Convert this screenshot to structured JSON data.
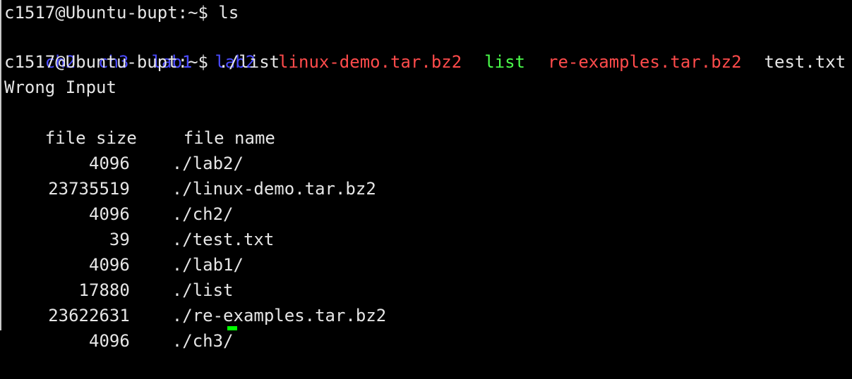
{
  "terminal": {
    "prompt_1": "c1517@Ubuntu-bupt:~$ ls",
    "ls_output": [
      {
        "name": "ch2",
        "color": "#4b4bff"
      },
      {
        "name": "ch3",
        "color": "#4b4bff"
      },
      {
        "name": "lab1",
        "color": "#4b4bff"
      },
      {
        "name": "lab2",
        "color": "#4b4bff"
      },
      {
        "name": "linux-demo.tar.bz2",
        "color": "#ff4b4b"
      },
      {
        "name": "list",
        "color": "#4bff4b"
      },
      {
        "name": "re-examples.tar.bz2",
        "color": "#ff4b4b"
      },
      {
        "name": "test.txt",
        "color": "#e6e6e6"
      }
    ],
    "prompt_2": "c1517@Ubuntu-bupt:~$ ./list",
    "message": "Wrong Input",
    "header_size": "file size",
    "header_name": "file name",
    "rows": [
      {
        "size": "4096",
        "name": "./lab2/"
      },
      {
        "size": "23735519",
        "name": "./linux-demo.tar.bz2"
      },
      {
        "size": "4096",
        "name": "./ch2/"
      },
      {
        "size": "39",
        "name": "./test.txt"
      },
      {
        "size": "4096",
        "name": "./lab1/"
      },
      {
        "size": "17880",
        "name": "./list"
      },
      {
        "size": "23622631",
        "name": "./re-examples.tar.bz2"
      },
      {
        "size": "4096",
        "name": "./ch3/"
      }
    ],
    "cursor_color": "#00ff00",
    "text_color": "#e6e6e6",
    "background_color": "#000000"
  }
}
